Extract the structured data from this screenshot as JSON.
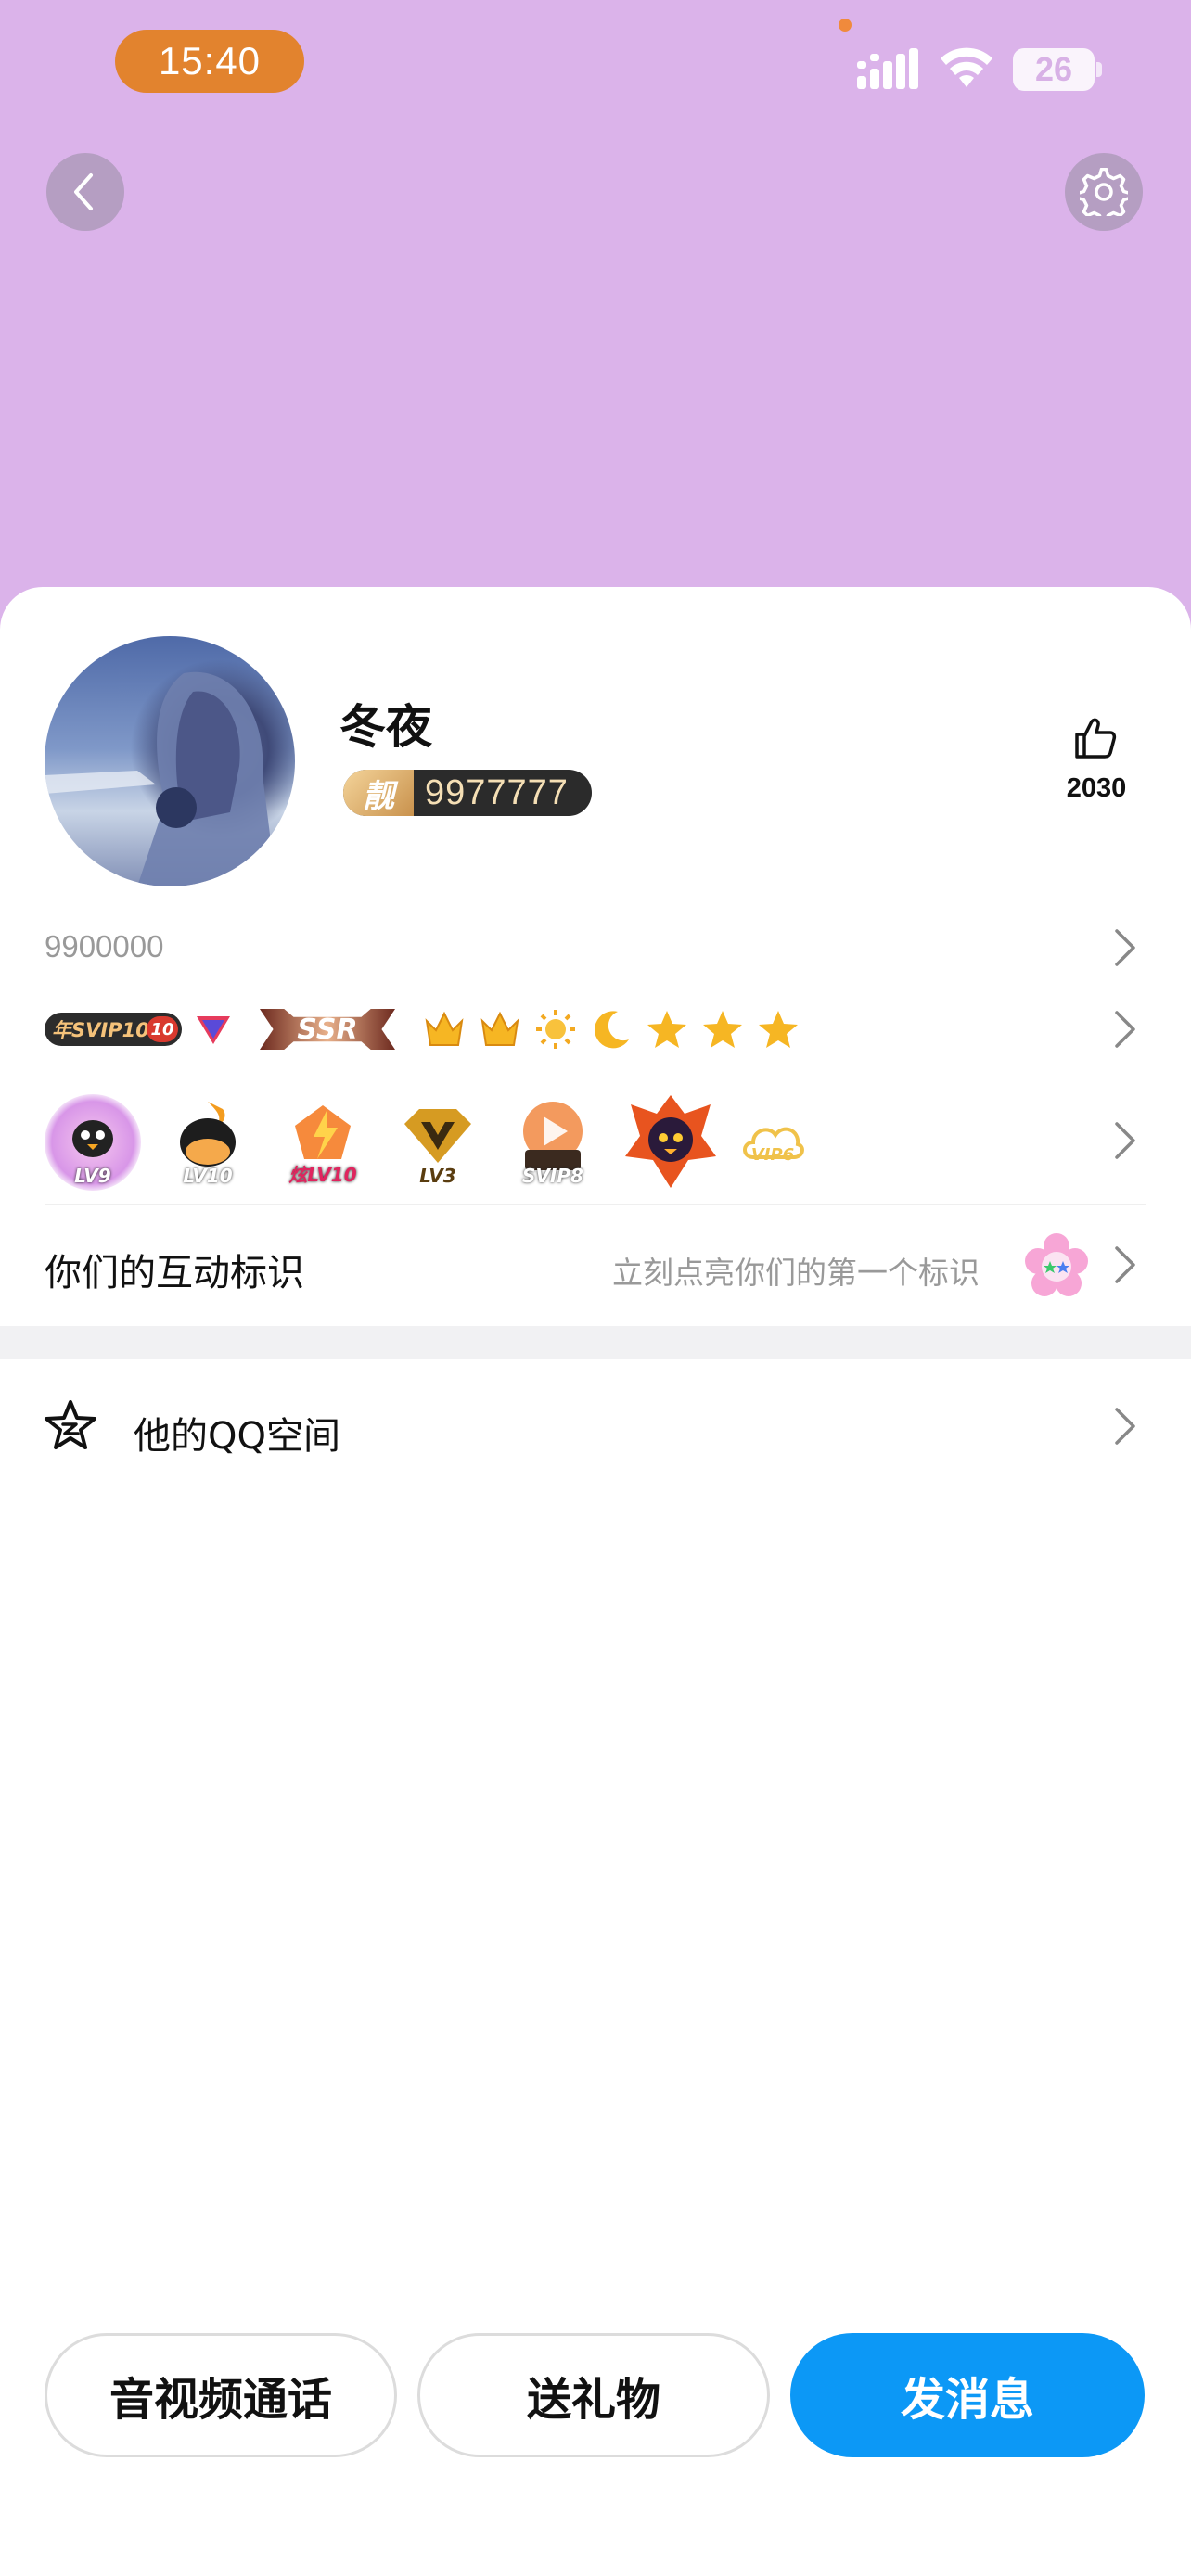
{
  "status_bar": {
    "time": "15:40",
    "battery": "26"
  },
  "header": {
    "background_color": "#dbb3ea",
    "back_icon": "chevron-left-icon",
    "settings_icon": "gear-icon"
  },
  "profile": {
    "nickname": "冬夜",
    "pretty_number_mark": "靓",
    "pretty_number": "9977777",
    "like_count": "2030",
    "account_id": "9900000"
  },
  "badges_row1": {
    "svip_text": "年SVIP10",
    "svip_level": "10",
    "ssr_text": "SSR",
    "level_icons": [
      "crown",
      "crown",
      "sun",
      "moon",
      "star",
      "star",
      "star"
    ]
  },
  "badges_row2": {
    "items": [
      "LV9",
      "LV10",
      "炫LV10",
      "LV3",
      "SVIP8",
      "",
      "VIP6"
    ]
  },
  "interaction": {
    "label": "你们的互动标识",
    "hint": "立刻点亮你们的第一个标识"
  },
  "qzone": {
    "label": "他的QQ空间"
  },
  "actions": {
    "call": "音视频通话",
    "gift": "送礼物",
    "message": "发消息",
    "accent_color": "#0c98f6"
  }
}
